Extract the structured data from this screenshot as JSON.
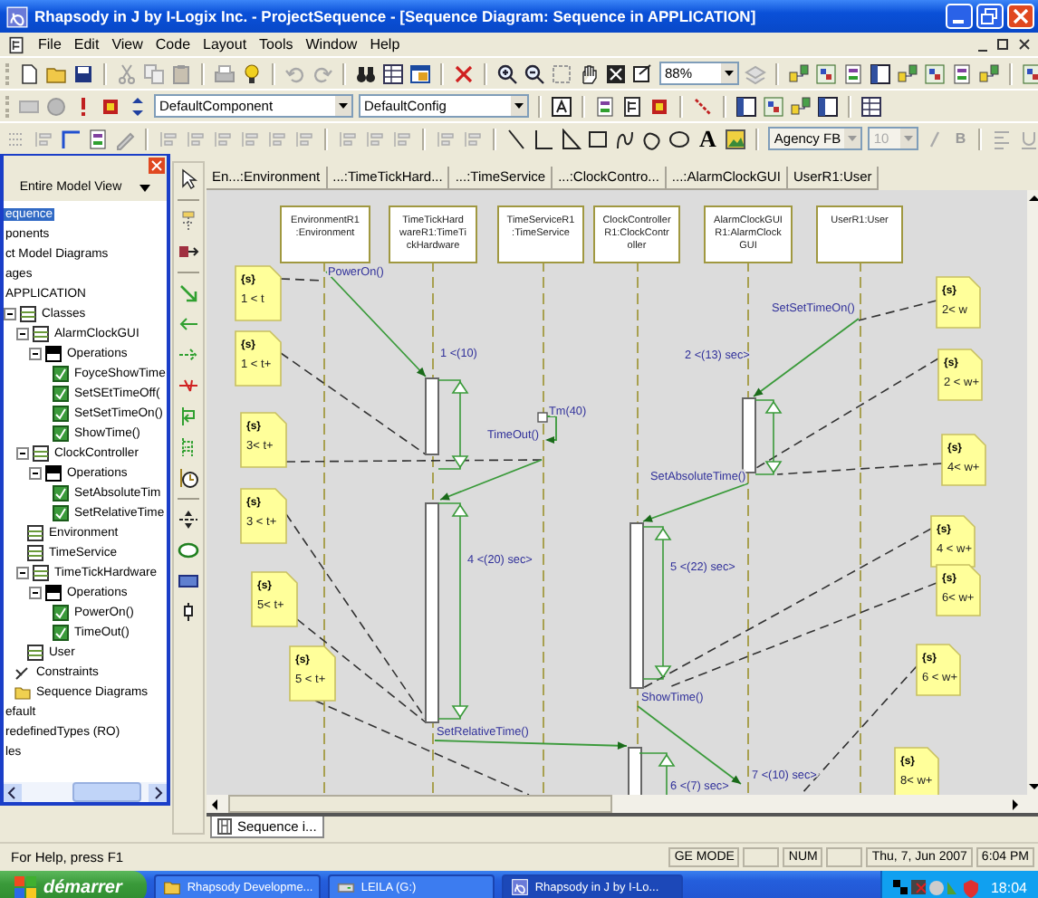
{
  "window": {
    "title": "Rhapsody in J by I-Logix Inc. - ProjectSequence - [Sequence Diagram: Sequence in APPLICATION]"
  },
  "menu": [
    "File",
    "Edit",
    "View",
    "Code",
    "Layout",
    "Tools",
    "Window",
    "Help"
  ],
  "toolbar": {
    "zoom": "88%",
    "component": "DefaultComponent",
    "config": "DefaultConfig",
    "text_tool": "A",
    "font": "Agency FB",
    "font_size": "10",
    "bold": "B"
  },
  "browser": {
    "view": "Entire Model View",
    "tree": [
      {
        "label": "equence",
        "selected": true
      },
      {
        "label": "ponents",
        "selected": false
      },
      {
        "label": "ct Model Diagrams",
        "selected": false
      },
      {
        "label": "ages",
        "selected": false
      },
      {
        "label": "APPLICATION",
        "selected": false,
        "children": [
          {
            "label": "Classes",
            "kind": "folder",
            "selected": false,
            "children": [
              {
                "label": "AlarmClockGUI",
                "kind": "class",
                "selected": false,
                "children": [
                  {
                    "label": "Operations",
                    "kind": "operations",
                    "selected": false,
                    "children": [
                      {
                        "label": "FoyceShowTime",
                        "kind": "operation",
                        "selected": false
                      },
                      {
                        "label": "SetSEtTimeOff(",
                        "kind": "operation",
                        "selected": false
                      },
                      {
                        "label": "SetSetTimeOn()",
                        "kind": "operation",
                        "selected": false
                      },
                      {
                        "label": "ShowTime()",
                        "kind": "operation",
                        "selected": false
                      }
                    ]
                  }
                ]
              },
              {
                "label": "ClockController",
                "kind": "class",
                "selected": false,
                "children": [
                  {
                    "label": "Operations",
                    "kind": "operations",
                    "selected": false,
                    "children": [
                      {
                        "label": "SetAbsoluteTim",
                        "kind": "operation",
                        "selected": false
                      },
                      {
                        "label": "SetRelativeTime",
                        "kind": "operation",
                        "selected": false
                      }
                    ]
                  }
                ]
              },
              {
                "label": "Environment",
                "kind": "class",
                "selected": false
              },
              {
                "label": "TimeService",
                "kind": "class",
                "selected": false
              },
              {
                "label": "TimeTickHardware",
                "kind": "class",
                "selected": false,
                "children": [
                  {
                    "label": "Operations",
                    "kind": "operations",
                    "selected": false,
                    "children": [
                      {
                        "label": "PowerOn()",
                        "kind": "operation",
                        "selected": false
                      },
                      {
                        "label": "TimeOut()",
                        "kind": "operation",
                        "selected": false
                      }
                    ]
                  }
                ]
              },
              {
                "label": "User",
                "kind": "class",
                "selected": false
              }
            ]
          },
          {
            "label": "Constraints",
            "kind": "constraints",
            "selected": false
          },
          {
            "label": "Sequence Diagrams",
            "kind": "diagrams",
            "selected": false
          }
        ]
      },
      {
        "label": "efault",
        "selected": false
      },
      {
        "label": "redefinedTypes (RO)",
        "selected": false
      },
      {
        "label": "les",
        "selected": false
      }
    ]
  },
  "diagram": {
    "column_headers": [
      "En...:Environment",
      "...:TimeTickHard...",
      "...:TimeService",
      "...:ClockContro...",
      "...:AlarmClockGUI",
      "UserR1:User"
    ],
    "lifelines": [
      {
        "lines": [
          "EnvironmentR1",
          ":Environment"
        ]
      },
      {
        "lines": [
          "TimeTickHard",
          "wareR1:TimeTi",
          "ckHardware"
        ]
      },
      {
        "lines": [
          "TimeServiceR1",
          ":TimeService"
        ]
      },
      {
        "lines": [
          "ClockController",
          "R1:ClockContr",
          "oller"
        ]
      },
      {
        "lines": [
          "AlarmClockGUI",
          "R1:AlarmClock",
          "GUI"
        ]
      },
      {
        "lines": [
          "UserR1:User"
        ]
      }
    ],
    "messages": [
      {
        "label": "PowerOn()",
        "kind": "message"
      },
      {
        "label": "SetSetTimeOn()",
        "kind": "message"
      },
      {
        "label": "1 <(10)",
        "kind": "interval"
      },
      {
        "label": "2 <(13) sec>",
        "kind": "interval"
      },
      {
        "label": "Tm(40)",
        "kind": "timer"
      },
      {
        "label": "TimeOut()",
        "kind": "message"
      },
      {
        "label": "SetAbsoluteTime()",
        "kind": "message"
      },
      {
        "label": "4 <(20) sec>",
        "kind": "interval"
      },
      {
        "label": "5 <(22) sec>",
        "kind": "interval"
      },
      {
        "label": "ShowTime()",
        "kind": "message"
      },
      {
        "label": "SetRelativeTime()",
        "kind": "message"
      },
      {
        "label": "7 <(10) sec>",
        "kind": "interval"
      },
      {
        "label": "6 <(7) sec>",
        "kind": "interval"
      }
    ],
    "notes": [
      {
        "tag": "{s}",
        "text": "1 < t"
      },
      {
        "tag": "{s}",
        "text": "1 < t+"
      },
      {
        "tag": "{s}",
        "text": "3< t+"
      },
      {
        "tag": "{s}",
        "text": "3 < t+"
      },
      {
        "tag": "{s}",
        "text": "5< t+"
      },
      {
        "tag": "{s}",
        "text": "5 < t+"
      },
      {
        "tag": "{s}",
        "text": "2< w"
      },
      {
        "tag": "{s}",
        "text": "2 < w+"
      },
      {
        "tag": "{s}",
        "text": "4< w+"
      },
      {
        "tag": "{s}",
        "text": "4 < w+"
      },
      {
        "tag": "{s}",
        "text": "6< w+"
      },
      {
        "tag": "{s}",
        "text": "6 < w+"
      },
      {
        "tag": "{s}",
        "text": "8< w+"
      }
    ]
  },
  "document_tabs": [
    {
      "label": "Sequence i...",
      "selected": true
    }
  ],
  "status_bar": {
    "help": "For Help, press F1",
    "mode": "GE MODE",
    "num": "NUM",
    "date": "Thu, 7, Jun 2007",
    "time": "6:04 PM"
  },
  "taskbar": {
    "start": "démarrer",
    "tasks": [
      {
        "label": "Rhapsody Developme...",
        "selected": false
      },
      {
        "label": "LEILA (G:)",
        "selected": false
      },
      {
        "label": "Rhapsody in J by I-Lo...",
        "selected": true
      }
    ],
    "clock": "18:04"
  }
}
